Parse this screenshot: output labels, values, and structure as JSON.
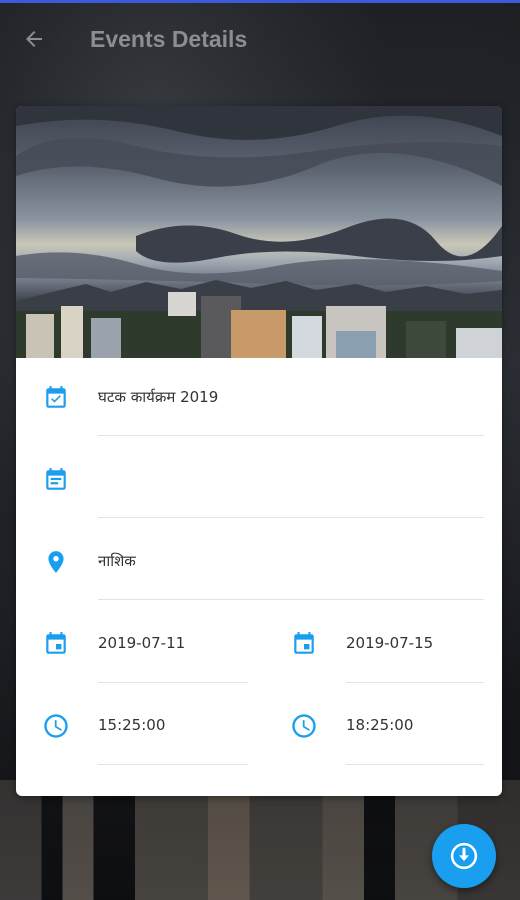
{
  "appbar": {
    "title": "Events Details",
    "back_icon": "arrow-back-icon"
  },
  "event": {
    "name": "घटक कार्यक्रम 2019",
    "description": "",
    "location": "नाशिक",
    "start_date": "2019-07-11",
    "end_date": "2019-07-15",
    "start_time": "15:25:00",
    "end_time": "18:25:00"
  },
  "icons": {
    "name": "calendar-check-icon",
    "description": "event-note-icon",
    "location": "location-pin-icon",
    "date": "calendar-event-icon",
    "time": "clock-icon",
    "fab": "download-circle-icon"
  },
  "colors": {
    "accent": "#1A9EF0",
    "appbar_text": "#8A8D93",
    "field_text": "#333333"
  }
}
